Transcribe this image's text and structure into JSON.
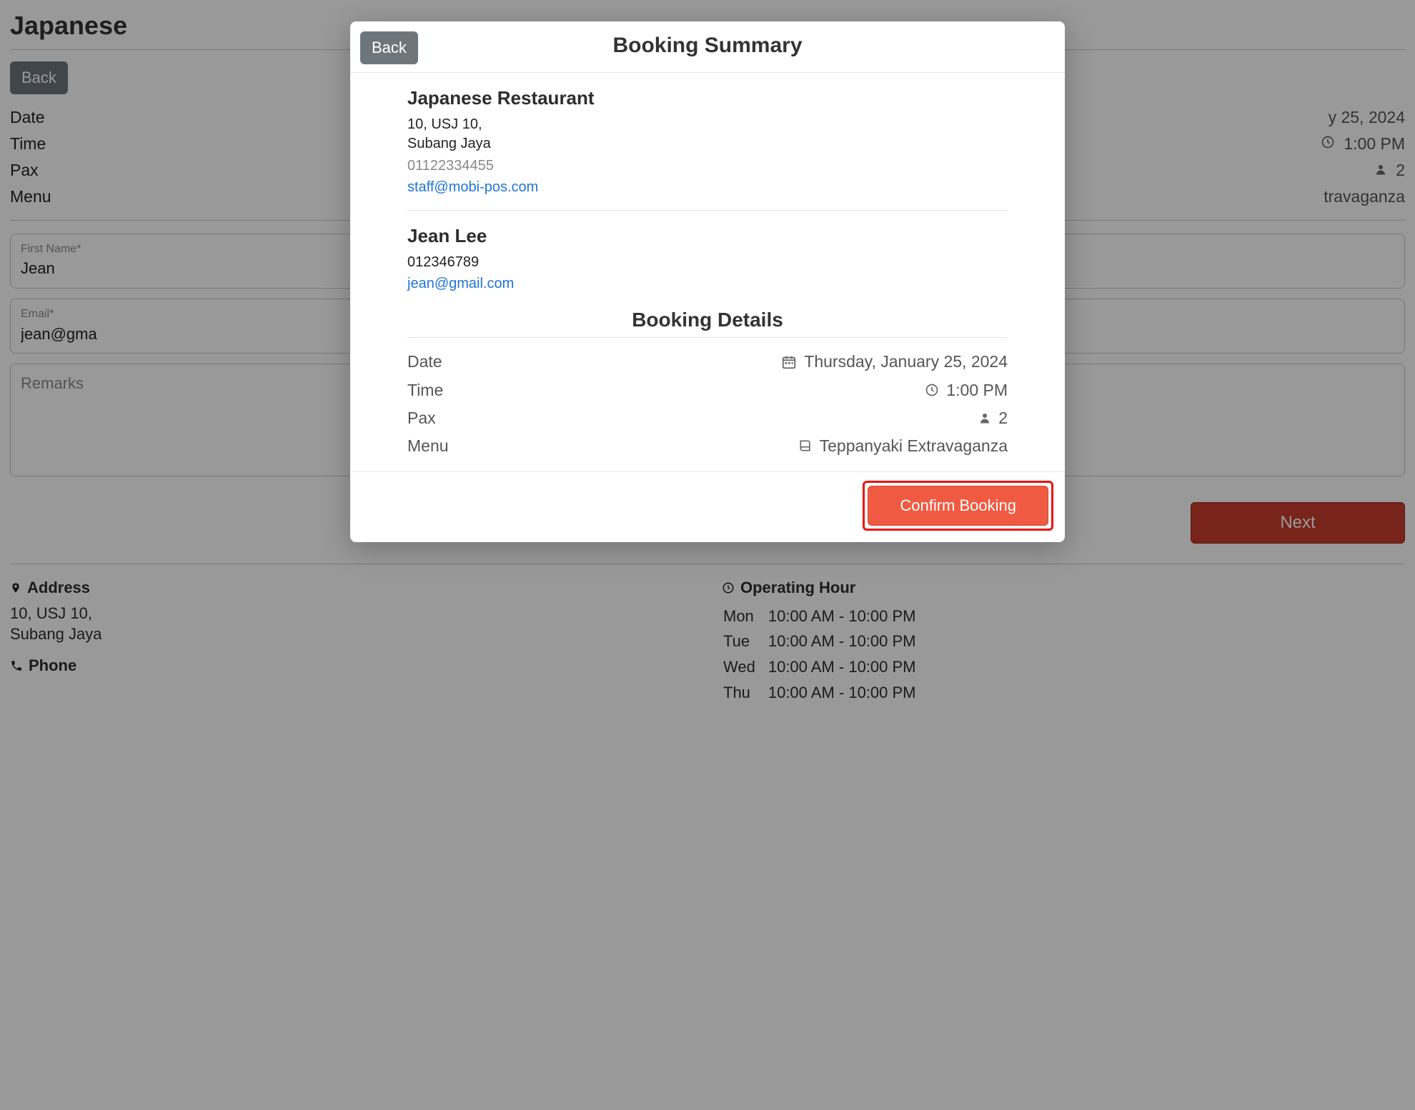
{
  "bg": {
    "title": "Japanese",
    "back_label": "Back",
    "rows": {
      "date_label": "Date",
      "date_value_suffix": "y 25, 2024",
      "time_label": "Time",
      "time_value": "1:00 PM",
      "pax_label": "Pax",
      "pax_value": "2",
      "menu_label": "Menu",
      "menu_value_suffix": "travaganza"
    },
    "form": {
      "first_name_label": "First Name*",
      "first_name_value": "Jean",
      "email_label": "Email*",
      "email_value": "jean@gma",
      "remarks_placeholder": "Remarks"
    },
    "next_label": "Next",
    "footer": {
      "address_label": "Address",
      "address_line1": "10, USJ 10,",
      "address_line2": "Subang Jaya",
      "phone_label": "Phone",
      "hours_label": "Operating Hour",
      "hours": [
        {
          "day": "Mon",
          "range": "10:00 AM - 10:00 PM"
        },
        {
          "day": "Tue",
          "range": "10:00 AM - 10:00 PM"
        },
        {
          "day": "Wed",
          "range": "10:00 AM - 10:00 PM"
        },
        {
          "day": "Thu",
          "range": "10:00 AM - 10:00 PM"
        }
      ]
    }
  },
  "modal": {
    "back_label": "Back",
    "title": "Booking Summary",
    "restaurant": {
      "name": "Japanese Restaurant",
      "address_line1": "10, USJ 10,",
      "address_line2": "Subang Jaya",
      "phone": "01122334455",
      "email": "staff@mobi-pos.com"
    },
    "customer": {
      "name": "Jean Lee",
      "phone": "012346789",
      "email": "jean@gmail.com"
    },
    "details_heading": "Booking Details",
    "details": {
      "date_label": "Date",
      "date_value": "Thursday, January 25, 2024",
      "time_label": "Time",
      "time_value": "1:00 PM",
      "pax_label": "Pax",
      "pax_value": "2",
      "menu_label": "Menu",
      "menu_value": "Teppanyaki Extravaganza"
    },
    "confirm_label": "Confirm Booking"
  }
}
